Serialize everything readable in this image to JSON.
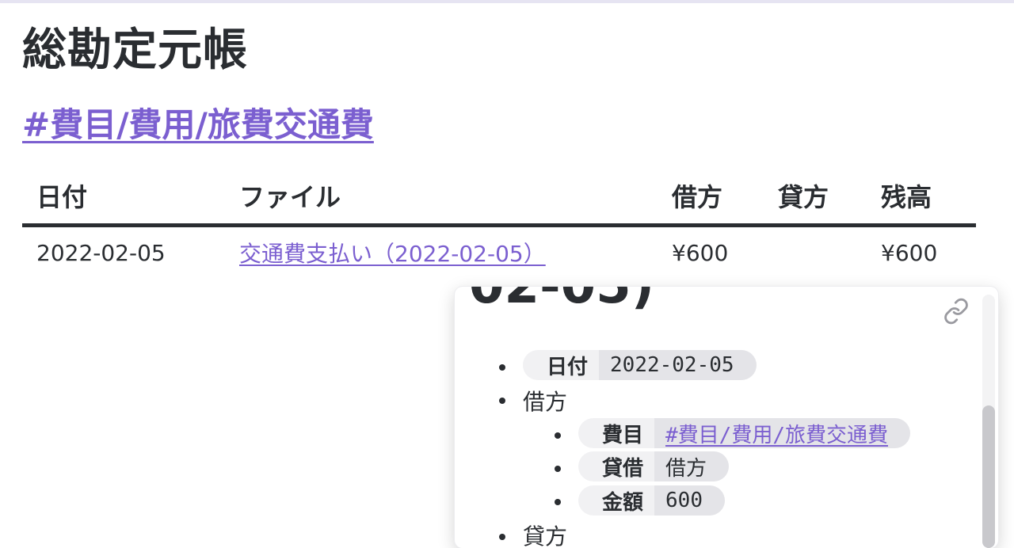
{
  "page": {
    "title": "総勘定元帳",
    "tag": "#費目/費用/旅費交通費"
  },
  "table": {
    "headers": [
      "日付",
      "ファイル",
      "借方",
      "貸方",
      "残高"
    ],
    "rows": [
      {
        "date": "2022-02-05",
        "file": "交通費支払い（2022-02-05）",
        "debit": "¥600",
        "credit": "",
        "balance": "¥600"
      }
    ]
  },
  "preview": {
    "clipped_title": "02-05)",
    "link_icon": "link-icon",
    "date_key": "日付",
    "date_value": "2022-02-05",
    "debit_label": "借方",
    "expense_key": "費目",
    "expense_value": "#費目/費用/旅費交通費",
    "side_key": "貸借",
    "side_value": "借方",
    "amount_key": "金額",
    "amount_value": "600",
    "credit_label": "貸方"
  },
  "colors": {
    "accent": "#7b5fd0",
    "text": "#2a2d31",
    "chip_key_bg": "#f1f1f3",
    "chip_val_bg": "#e4e4e8"
  }
}
